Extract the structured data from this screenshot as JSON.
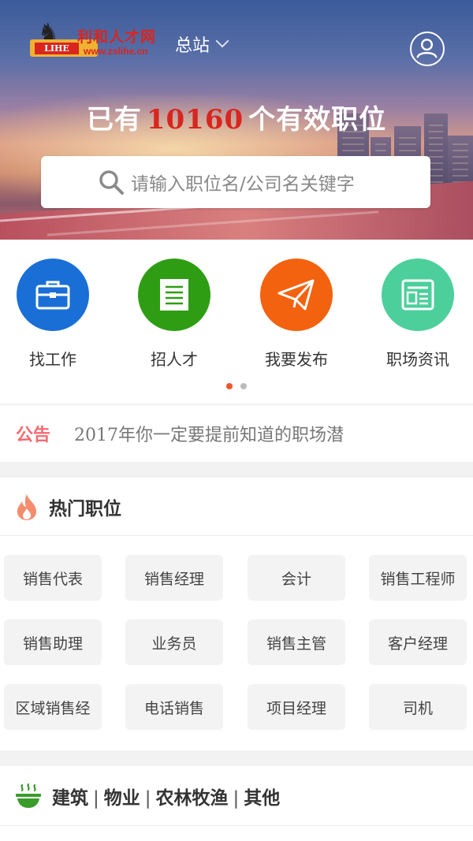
{
  "header": {
    "logo": {
      "badge_text": "LIHE",
      "name": "利和人才网",
      "url": "www.zslihe.cn"
    },
    "station": "总站",
    "headline_prefix": "已有",
    "job_count": "10160",
    "headline_suffix": "个有效职位",
    "search_placeholder": "请输入职位名/公司名关键字"
  },
  "quick_nav": {
    "items": [
      {
        "label": "找工作",
        "icon": "briefcase-icon",
        "color": "#1a6fd6"
      },
      {
        "label": "招人才",
        "icon": "document-list-icon",
        "color": "#2f9d14"
      },
      {
        "label": "我要发布",
        "icon": "paper-plane-icon",
        "color": "#f2620f"
      },
      {
        "label": "职场资讯",
        "icon": "news-icon",
        "color": "#4ccf9b"
      }
    ],
    "page_count": 2,
    "active_page": 1
  },
  "notice": {
    "tag": "公告",
    "text": "2017年你一定要提前知道的职场潜"
  },
  "hot_jobs": {
    "title": "热门职位",
    "items": [
      "销售代表",
      "销售经理",
      "会计",
      "销售工程师",
      "销售助理",
      "业务员",
      "销售主管",
      "客户经理",
      "区域销售经",
      "电话销售",
      "项目经理",
      "司机"
    ]
  },
  "category": {
    "parts": [
      "建筑",
      "物业",
      "农林牧渔",
      "其他"
    ],
    "separator": "|"
  },
  "colors": {
    "accent": "#f0562b",
    "count_red": "#d8261f",
    "notice_pink": "#f56b72"
  }
}
